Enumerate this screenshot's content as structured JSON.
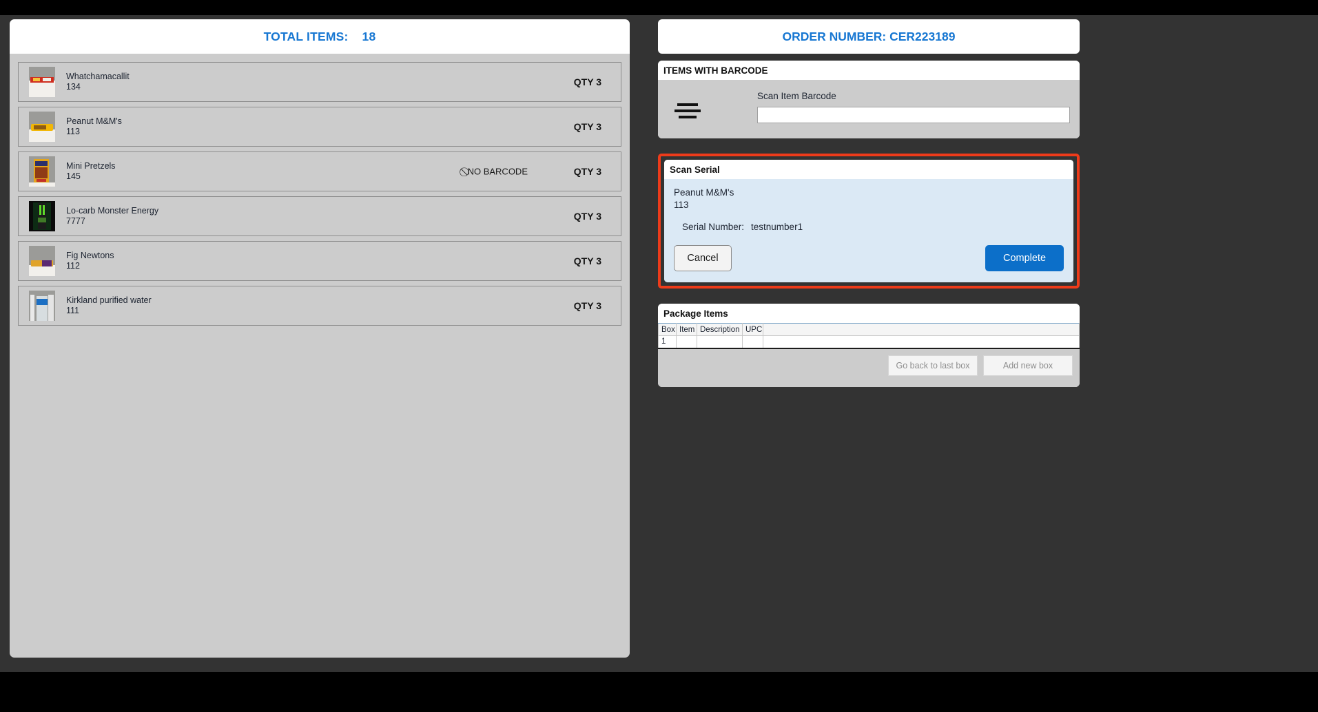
{
  "left_panel": {
    "header_label": "TOTAL ITEMS:",
    "total_items": "18",
    "accent_color": "#1777d2",
    "items": [
      {
        "name": "Whatchamacallit",
        "sku": "134",
        "qty": "QTY 3",
        "no_barcode": "",
        "thumb": "candy-bar-thumb"
      },
      {
        "name": "Peanut M&M's",
        "sku": "113",
        "qty": "QTY 3",
        "no_barcode": "",
        "thumb": "mm-bag-thumb"
      },
      {
        "name": "Mini Pretzels",
        "sku": "145",
        "qty": "QTY 3",
        "no_barcode": "NO BARCODE",
        "thumb": "pretzel-bag-thumb"
      },
      {
        "name": "Lo-carb Monster Energy",
        "sku": "7777",
        "qty": "QTY 3",
        "no_barcode": "",
        "thumb": "monster-can-thumb"
      },
      {
        "name": "Fig Newtons",
        "sku": "112",
        "qty": "QTY 3",
        "no_barcode": "",
        "thumb": "fig-newtons-thumb"
      },
      {
        "name": "Kirkland purified water",
        "sku": "111",
        "qty": "QTY 3",
        "no_barcode": "",
        "thumb": "water-bottle-thumb"
      }
    ],
    "no_barcode_icon": "⃠"
  },
  "right_panel": {
    "order_header": "ORDER NUMBER: CER223189",
    "accent_color": "#1777d2",
    "items_with_barcode": {
      "title": "ITEMS WITH BARCODE",
      "field_label": "Scan Item Barcode",
      "input_value": "",
      "input_placeholder": ""
    },
    "scan_serial": {
      "title": "Scan Serial",
      "item_name": "Peanut M&M's",
      "item_sku": "113",
      "serial_label": "Serial Number:",
      "serial_value": "testnumber1",
      "cancel_label": "Cancel",
      "complete_label": "Complete",
      "highlight_color": "#ee3b1a",
      "complete_color": "#0c6fc9"
    },
    "package_items": {
      "title": "Package Items",
      "columns": [
        "Box",
        "Item",
        "Description",
        "UPC"
      ],
      "rows": [
        {
          "box": "1",
          "item": "",
          "description": "",
          "upc": ""
        }
      ],
      "go_back_label": "Go back to last box",
      "add_box_label": "Add new box"
    }
  }
}
